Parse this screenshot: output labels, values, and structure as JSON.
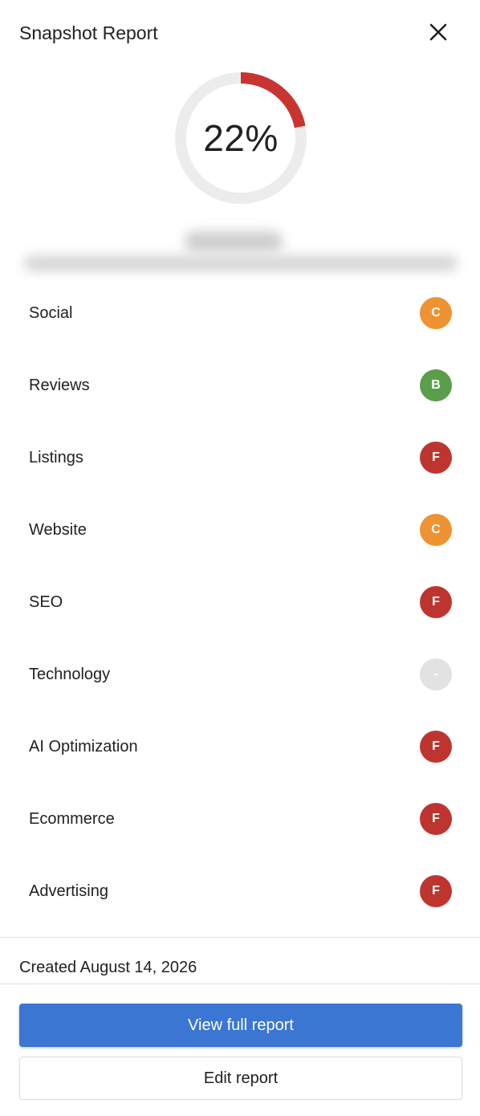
{
  "header": {
    "title": "Snapshot Report",
    "close_icon": "close-icon"
  },
  "score": {
    "value": 22,
    "label": "22%",
    "track_color": "#ececec",
    "fill_color": "#c8342f"
  },
  "categories": [
    {
      "label": "Social",
      "grade": "C",
      "color": "#ef9232"
    },
    {
      "label": "Reviews",
      "grade": "B",
      "color": "#5a9e4b"
    },
    {
      "label": "Listings",
      "grade": "F",
      "color": "#be3530"
    },
    {
      "label": "Website",
      "grade": "C",
      "color": "#ef9232"
    },
    {
      "label": "SEO",
      "grade": "F",
      "color": "#be3530"
    },
    {
      "label": "Technology",
      "grade": "-",
      "color": "#e2e2e2"
    },
    {
      "label": "AI Optimization",
      "grade": "F",
      "color": "#be3530"
    },
    {
      "label": "Ecommerce",
      "grade": "F",
      "color": "#be3530"
    },
    {
      "label": "Advertising",
      "grade": "F",
      "color": "#be3530"
    }
  ],
  "footer": {
    "created": "Created August 14, 2026"
  },
  "actions": {
    "view_label": "View full report",
    "edit_label": "Edit report",
    "primary_color": "#3b76d3"
  }
}
